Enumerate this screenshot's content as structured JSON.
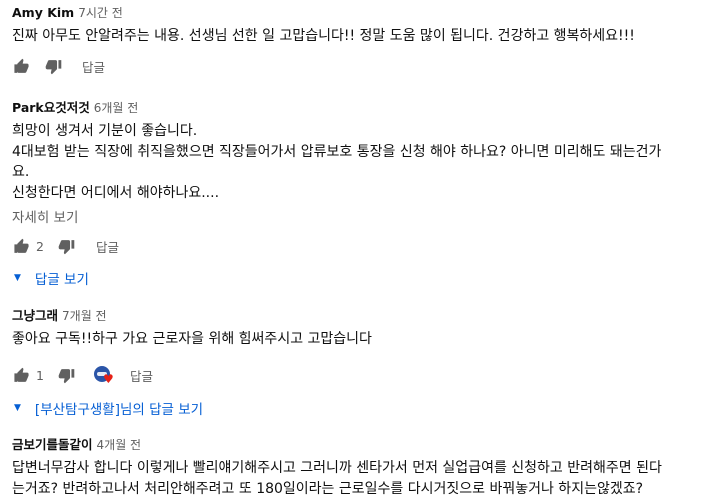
{
  "comments": [
    {
      "author": "Amy Kim",
      "time": "7시간 전",
      "lines": [
        "진짜 아무도 안알려주는 내용. 선생님 선한 일 고맙습니다!! 정말 도움 많이 됩니다. 건강하고 행복하세요!!!"
      ],
      "reply": "답글"
    },
    {
      "author": "Park요것저것",
      "time": "6개월 전",
      "lines": [
        "희망이 생겨서 기분이 좋습니다.",
        "4대보험 받는 직장에 취직을했으면 직장들어가서 압류보호 통장을 신청 해야 하나요? 아니면 미리해도 돼는건가",
        "요.",
        "신청한다면 어디에서 해야하나요...."
      ],
      "more": "자세히 보기",
      "likes": "2",
      "reply": "답글",
      "replies": "답글 보기"
    },
    {
      "author": "그냥그래",
      "time": "7개월 전",
      "lines": [
        "좋아요 구독!!하구 가요 근로자을 위해 힘써주시고 고맙습니다"
      ],
      "likes": "1",
      "reply": "답글",
      "replies": "[부산탐구생활]님의 답글 보기"
    },
    {
      "author": "금보기를돌같이",
      "time": "4개월 전",
      "lines": [
        "답변너무감사 합니다 이렇게나 빨리얘기해주시고 그러니까 센타가서 먼저 실업급여를 신청하고 반려해주면 된다",
        "는거죠? 반려하고나서 처리안해주려고 또 180일이라는 근로일수를 다시거짓으로 바꿔놓거나 하지는않겠죠?"
      ]
    }
  ],
  "icons": {
    "like": "thumb-up-icon",
    "dislike": "thumb-down-icon",
    "expand": "caret-down-icon",
    "heart": "creator-heart-icon"
  },
  "colors": {
    "link": "#065fd4",
    "muted": "#606060",
    "heart": "#e62117"
  }
}
